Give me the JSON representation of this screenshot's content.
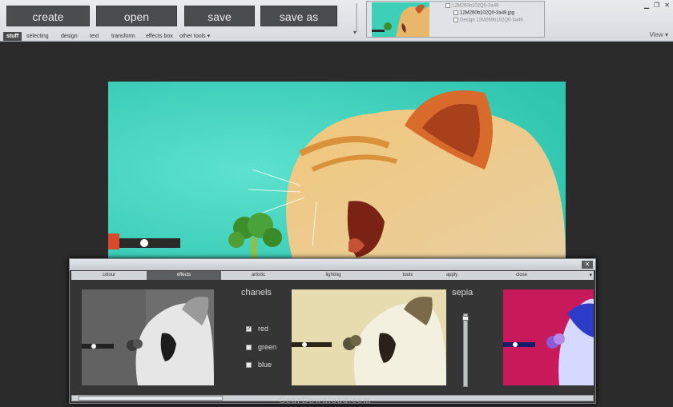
{
  "toolbar": {
    "create_label": "create",
    "open_label": "open",
    "save_label": "save",
    "save_as_label": "save as"
  },
  "tabs": [
    "stuff",
    "selecting",
    "design",
    "text",
    "transform",
    "effects box",
    "other tools ▾"
  ],
  "file_panel": {
    "items": [
      "12M260b102Q0-3a49",
      "12M260b102Q0-3a49.jpg",
      "Design 12M260b102Q0-3a49"
    ]
  },
  "window_controls": [
    "▁",
    "❐",
    "✕"
  ],
  "view_label": "View ▾",
  "dialog": {
    "close_label": "✕",
    "tabs": [
      "colour",
      "effects",
      "artistic",
      "lighting",
      "tools",
      "apply",
      "close"
    ],
    "dropdown_icon": "▾",
    "channels_title": "chanels",
    "channels": [
      {
        "label": "red",
        "checked": true
      },
      {
        "label": "green",
        "checked": false
      },
      {
        "label": "blue",
        "checked": false
      }
    ],
    "sepia_title": "sepia",
    "sepia_level": 0.02
  },
  "watermark": "GearDownload.com",
  "colors": {
    "toolbar_button": "#4a4d50",
    "canvas_bg": "#2b2b2b",
    "dialog_bg": "#353535",
    "image_teal": "#43d6c0",
    "accent_pink": "#c8195a"
  }
}
